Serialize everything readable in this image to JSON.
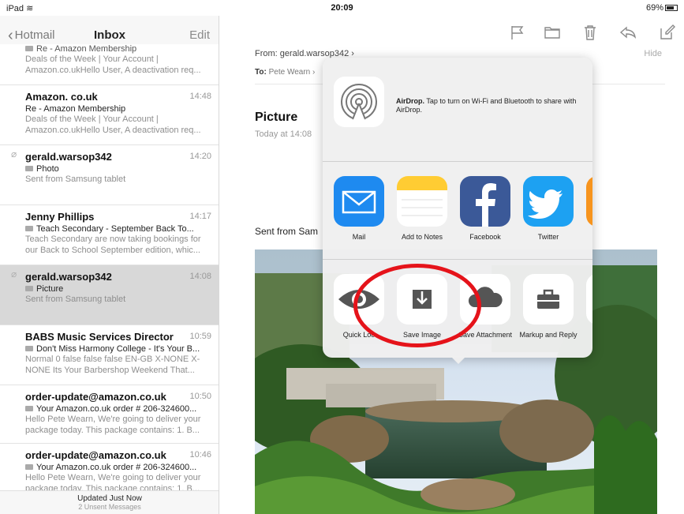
{
  "status_bar": {
    "device": "iPad",
    "time": "20:09",
    "battery": "69%"
  },
  "nav": {
    "back_label": "Hotmail",
    "title": "Inbox",
    "edit_label": "Edit"
  },
  "messages": [
    {
      "from": "",
      "time": "",
      "subject": "Re - Amazon Membership",
      "preview": "Deals of the Week | Your Account | Amazon.co.ukHello User, A deactivation req..."
    },
    {
      "from": "Amazon. co.uk",
      "time": "14:48",
      "subject": "Re - Amazon Membership",
      "preview": "Deals of the Week | Your Account | Amazon.co.ukHello User, A deactivation req..."
    },
    {
      "from": "gerald.warsop342",
      "time": "14:20",
      "subject": "Photo",
      "preview": "Sent from Samsung tablet"
    },
    {
      "from": "Jenny Phillips",
      "time": "14:17",
      "subject": "Teach Secondary - September Back To...",
      "preview": "Teach Secondary are now taking bookings for our Back to School September edition, whic..."
    },
    {
      "from": "gerald.warsop342",
      "time": "14:08",
      "subject": "Picture",
      "preview": "Sent from Samsung tablet"
    },
    {
      "from": "BABS Music Services Director",
      "time": "10:59",
      "subject": "Don't Miss Harmony College - It's Your B...",
      "preview": "Normal 0 false false false EN-GB X-NONE X-NONE Its Your Barbershop Weekend That..."
    },
    {
      "from": "order-update@amazon.co.uk",
      "time": "10:50",
      "subject": "Your Amazon.co.uk order # 206-324600...",
      "preview": "Hello Pete Wearn, We're going to deliver your package today. This package contains: 1. B..."
    },
    {
      "from": "order-update@amazon.co.uk",
      "time": "10:46",
      "subject": "Your Amazon.co.uk order # 206-324600...",
      "preview": "Hello Pete Wearn, We're going to deliver your package today. This package contains: 1. B..."
    }
  ],
  "footer": {
    "updated": "Updated Just Now",
    "unsent": "2 Unsent Messages"
  },
  "email": {
    "from": "From: gerald.warsop342 ›",
    "to_label": "To:",
    "to_value": "Pete Wearn ›",
    "hide": "Hide",
    "subject": "Picture",
    "date": "Today at 14:08",
    "body": "Sent from Sam"
  },
  "share_sheet": {
    "airdrop_title": "AirDrop.",
    "airdrop_text": "Tap to turn on Wi-Fi and Bluetooth to share with AirDrop.",
    "apps": [
      {
        "label": "Mail",
        "icon": "mail-icon"
      },
      {
        "label": "Add to Notes",
        "icon": "notes-icon"
      },
      {
        "label": "Facebook",
        "icon": "facebook-icon"
      },
      {
        "label": "Twitter",
        "icon": "twitter-icon"
      },
      {
        "label": "S",
        "icon": "app-icon"
      }
    ],
    "actions": [
      {
        "label": "Quick Loo",
        "icon": "eye-icon"
      },
      {
        "label": "Save Image",
        "icon": "save-image-icon"
      },
      {
        "label": "Save Attachment",
        "icon": "cloud-icon"
      },
      {
        "label": "Markup and Reply",
        "icon": "toolbox-icon"
      }
    ]
  },
  "colors": {
    "annotation": "#e5131a",
    "mail_blue": "#1e8af0",
    "facebook": "#3b5998",
    "twitter": "#1da1f2",
    "notes_yellow": "#ffcc33"
  }
}
